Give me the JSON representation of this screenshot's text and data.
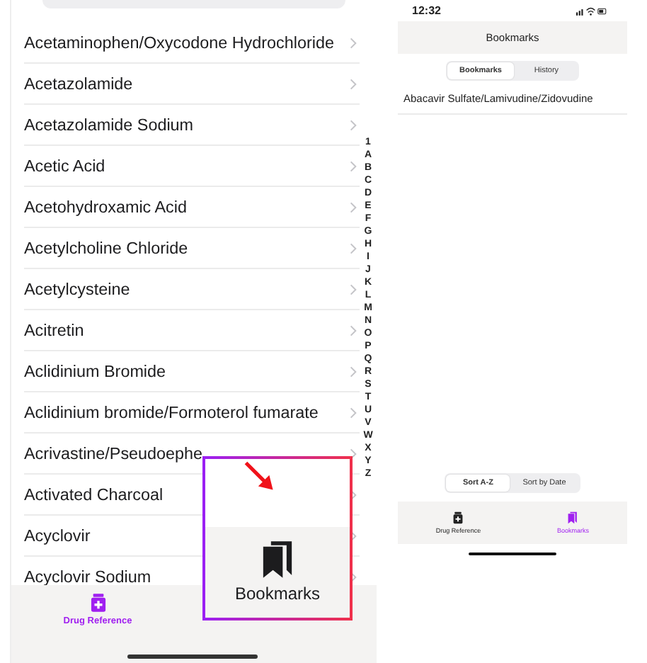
{
  "left_screen": {
    "drug_list": [
      "Acetaminophen/Oxycodone Hydrochloride",
      "Acetazolamide",
      "Acetazolamide Sodium",
      "Acetic Acid",
      "Acetohydroxamic Acid",
      "Acetylcholine Chloride",
      "Acetylcysteine",
      "Acitretin",
      "Aclidinium Bromide",
      "Aclidinium bromide/Formoterol fumarate",
      "Acrivastine/Pseudoephe",
      "Activated Charcoal",
      "Acyclovir",
      "Acyclovir Sodium"
    ],
    "index_letters": [
      "1",
      "A",
      "B",
      "C",
      "D",
      "E",
      "F",
      "G",
      "H",
      "I",
      "J",
      "K",
      "L",
      "M",
      "N",
      "O",
      "P",
      "Q",
      "R",
      "S",
      "T",
      "U",
      "V",
      "W",
      "X",
      "Y",
      "Z"
    ],
    "tab_bar": [
      {
        "label": "Drug Reference",
        "selected": true
      }
    ]
  },
  "callout": {
    "label": "Bookmarks"
  },
  "right_screen": {
    "status_bar": {
      "time": "12:32"
    },
    "title": "Bookmarks",
    "segments": [
      {
        "label": "Bookmarks",
        "selected": true
      },
      {
        "label": "History",
        "selected": false
      }
    ],
    "bookmarks": [
      "Abacavir Sulfate/Lamivudine/Zidovudine"
    ],
    "sort_options": [
      {
        "label": "Sort A-Z",
        "selected": true
      },
      {
        "label": "Sort by Date",
        "selected": false
      }
    ],
    "tab_bar": [
      {
        "label": "Drug Reference",
        "selected": false
      },
      {
        "label": "Bookmarks",
        "selected": true
      }
    ]
  }
}
